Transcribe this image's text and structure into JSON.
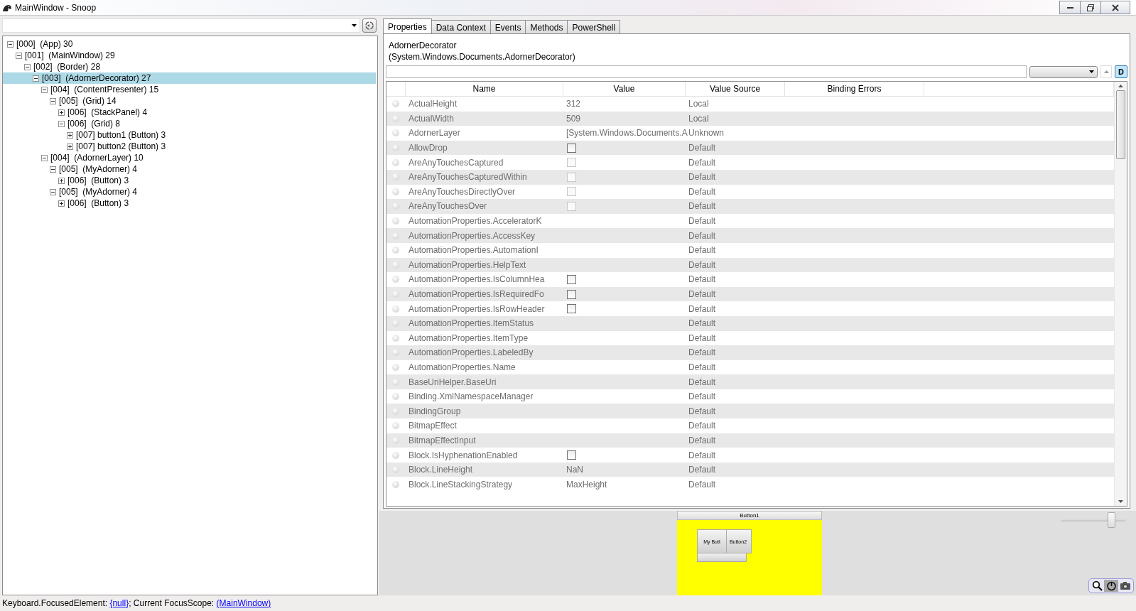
{
  "window": {
    "title": "MainWindow - Snoop"
  },
  "tree": [
    {
      "label": "[000]  (App) 30",
      "expanded": true,
      "selected": false,
      "children": [
        {
          "label": "[001]  (MainWindow) 29",
          "expanded": true,
          "selected": false,
          "children": [
            {
              "label": "[002]  (Border) 28",
              "expanded": true,
              "selected": false,
              "children": [
                {
                  "label": "[003]  (AdornerDecorator) 27",
                  "expanded": true,
                  "selected": true,
                  "children": [
                    {
                      "label": "[004]  (ContentPresenter) 15",
                      "expanded": true,
                      "selected": false,
                      "children": [
                        {
                          "label": "[005]  (Grid) 14",
                          "expanded": true,
                          "selected": false,
                          "children": [
                            {
                              "label": "[006]  (StackPanel) 4",
                              "expanded": false,
                              "selected": false
                            },
                            {
                              "label": "[006]  (Grid) 8",
                              "expanded": true,
                              "selected": false,
                              "children": [
                                {
                                  "label": "[007] button1 (Button) 3",
                                  "expanded": false,
                                  "selected": false
                                },
                                {
                                  "label": "[007] button2 (Button) 3",
                                  "expanded": false,
                                  "selected": false
                                }
                              ]
                            }
                          ]
                        }
                      ]
                    },
                    {
                      "label": "[004]  (AdornerLayer) 10",
                      "expanded": true,
                      "selected": false,
                      "children": [
                        {
                          "label": "[005]  (MyAdorner) 4",
                          "expanded": true,
                          "selected": false,
                          "children": [
                            {
                              "label": "[006]  (Button) 3",
                              "expanded": false,
                              "selected": false
                            }
                          ]
                        },
                        {
                          "label": "[005]  (MyAdorner) 4",
                          "expanded": true,
                          "selected": false,
                          "children": [
                            {
                              "label": "[006]  (Button) 3",
                              "expanded": false,
                              "selected": false
                            }
                          ]
                        }
                      ]
                    }
                  ]
                }
              ]
            }
          ]
        }
      ]
    }
  ],
  "tabs": [
    {
      "label": "Properties",
      "selected": true
    },
    {
      "label": "Data Context",
      "selected": false
    },
    {
      "label": "Events",
      "selected": false
    },
    {
      "label": "Methods",
      "selected": false
    },
    {
      "label": "PowerShell",
      "selected": false
    }
  ],
  "target": {
    "name": "AdornerDecorator",
    "type": "(System.Windows.Documents.AdornerDecorator)"
  },
  "filter_toggle": {
    "label": "D",
    "selected": true
  },
  "columns": [
    "Name",
    "Value",
    "Value Source",
    "Binding Errors"
  ],
  "properties": [
    {
      "name": "ActualHeight",
      "kind": "text",
      "value": "312",
      "source": "Local"
    },
    {
      "name": "ActualWidth",
      "kind": "text",
      "value": "509",
      "source": "Local"
    },
    {
      "name": "AdornerLayer",
      "kind": "text",
      "value": "[System.Windows.Documents.A",
      "source": "Unknown"
    },
    {
      "name": "AllowDrop",
      "kind": "checkbox",
      "checked": false,
      "disabled": false,
      "source": "Default"
    },
    {
      "name": "AreAnyTouchesCaptured",
      "kind": "checkbox",
      "checked": false,
      "disabled": true,
      "source": "Default"
    },
    {
      "name": "AreAnyTouchesCapturedWithin",
      "kind": "checkbox",
      "checked": false,
      "disabled": true,
      "source": "Default"
    },
    {
      "name": "AreAnyTouchesDirectlyOver",
      "kind": "checkbox",
      "checked": false,
      "disabled": true,
      "source": "Default"
    },
    {
      "name": "AreAnyTouchesOver",
      "kind": "checkbox",
      "checked": false,
      "disabled": true,
      "source": "Default"
    },
    {
      "name": "AutomationProperties.AcceleratorK",
      "kind": "empty",
      "source": "Default"
    },
    {
      "name": "AutomationProperties.AccessKey",
      "kind": "empty",
      "source": "Default"
    },
    {
      "name": "AutomationProperties.AutomationI",
      "kind": "empty",
      "source": "Default"
    },
    {
      "name": "AutomationProperties.HelpText",
      "kind": "empty",
      "source": "Default"
    },
    {
      "name": "AutomationProperties.IsColumnHea",
      "kind": "checkbox",
      "checked": false,
      "disabled": false,
      "source": "Default"
    },
    {
      "name": "AutomationProperties.IsRequiredFo",
      "kind": "checkbox",
      "checked": false,
      "disabled": false,
      "source": "Default"
    },
    {
      "name": "AutomationProperties.IsRowHeader",
      "kind": "checkbox",
      "checked": false,
      "disabled": false,
      "source": "Default"
    },
    {
      "name": "AutomationProperties.ItemStatus",
      "kind": "empty",
      "source": "Default"
    },
    {
      "name": "AutomationProperties.ItemType",
      "kind": "empty",
      "source": "Default"
    },
    {
      "name": "AutomationProperties.LabeledBy",
      "kind": "empty",
      "source": "Default"
    },
    {
      "name": "AutomationProperties.Name",
      "kind": "empty",
      "source": "Default"
    },
    {
      "name": "BaseUriHelper.BaseUri",
      "kind": "empty",
      "source": "Default"
    },
    {
      "name": "Binding.XmlNamespaceManager",
      "kind": "empty",
      "source": "Default"
    },
    {
      "name": "BindingGroup",
      "kind": "empty",
      "source": "Default"
    },
    {
      "name": "BitmapEffect",
      "kind": "empty",
      "source": "Default"
    },
    {
      "name": "BitmapEffectInput",
      "kind": "empty",
      "source": "Default"
    },
    {
      "name": "Block.IsHyphenationEnabled",
      "kind": "checkbox",
      "checked": false,
      "disabled": false,
      "source": "Default"
    },
    {
      "name": "Block.LineHeight",
      "kind": "text",
      "value": "NaN",
      "source": "Default"
    },
    {
      "name": "Block.LineStackingStrategy",
      "kind": "text",
      "value": "MaxHeight",
      "source": "Default"
    }
  ],
  "preview": {
    "top_button": "Button1",
    "adorner_button": "My Butt",
    "main_button": "Button2",
    "zoom": {
      "level": 0.75
    },
    "tools": [
      {
        "kind": "magnifier",
        "selected": false
      },
      {
        "kind": "power",
        "selected": true
      },
      {
        "kind": "camera",
        "selected": false
      }
    ]
  },
  "status_bar": {
    "focused_label": "Keyboard.FocusedElement:",
    "focused_value": "{null}",
    "scope_label": "; Current FocusScope:",
    "scope_value": "(MainWindow)"
  }
}
